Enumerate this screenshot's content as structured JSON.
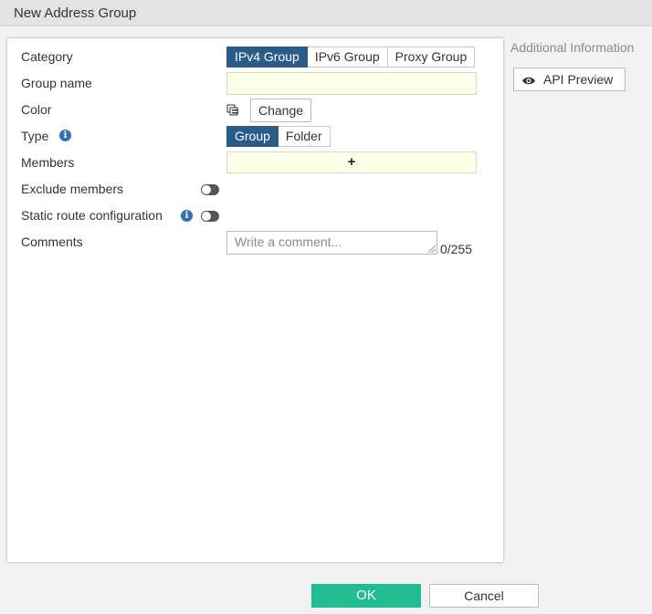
{
  "window": {
    "title": "New Address Group"
  },
  "form": {
    "category": {
      "label": "Category",
      "options": [
        "IPv4 Group",
        "IPv6 Group",
        "Proxy Group"
      ],
      "selected": "IPv4 Group"
    },
    "group_name": {
      "label": "Group name",
      "value": ""
    },
    "color": {
      "label": "Color",
      "change_label": "Change"
    },
    "type": {
      "label": "Type",
      "options": [
        "Group",
        "Folder"
      ],
      "selected": "Group"
    },
    "members": {
      "label": "Members",
      "add_symbol": "+"
    },
    "exclude_members": {
      "label": "Exclude members",
      "enabled": false
    },
    "static_route": {
      "label": "Static route configuration",
      "enabled": false
    },
    "comments": {
      "label": "Comments",
      "placeholder": "Write a comment...",
      "counter": "0/255"
    }
  },
  "sidebar": {
    "title": "Additional Information",
    "api_preview_label": "API Preview"
  },
  "footer": {
    "ok_label": "OK",
    "cancel_label": "Cancel"
  },
  "colors": {
    "accent": "#2b5c87",
    "ok_button": "#22bc93",
    "info_icon": "#2f70b7"
  }
}
